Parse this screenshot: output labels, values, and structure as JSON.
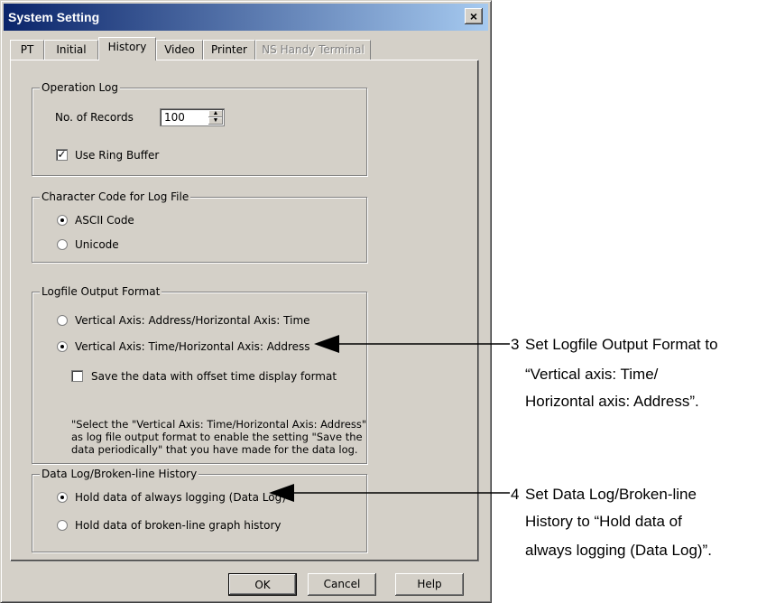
{
  "window": {
    "title": "System Setting",
    "close_glyph": "×"
  },
  "tabs": [
    "PT",
    "Initial",
    "History",
    "Video",
    "Printer",
    "NS Handy Terminal"
  ],
  "operation_log": {
    "legend": "Operation Log",
    "records_label": "No. of Records",
    "records_value": "100",
    "ring_buffer_label": "Use Ring Buffer",
    "ring_buffer_checked": true
  },
  "char_code": {
    "legend": "Character Code for Log File",
    "options": [
      "ASCII Code",
      "Unicode"
    ],
    "selected": 0
  },
  "output_format": {
    "legend": "Logfile Output Format",
    "options": [
      "Vertical Axis: Address/Horizontal Axis: Time",
      "Vertical Axis: Time/Horizontal Axis: Address"
    ],
    "selected": 1,
    "offset_label": "Save the data with offset time display format",
    "offset_checked": false,
    "note": "\"Select the \"Vertical Axis: Time/Horizontal Axis: Address\" as log file output format to enable the setting \"Save the data periodically\" that you have made for the data log."
  },
  "data_log": {
    "legend": "Data Log/Broken-line History",
    "options": [
      "Hold data of always logging (Data Log)",
      "Hold data of broken-line graph history"
    ],
    "selected": 0
  },
  "buttons": {
    "ok": "OK",
    "cancel": "Cancel",
    "help": "Help"
  },
  "annotations": {
    "step3": {
      "num": "3",
      "lines": [
        "Set Logfile Output Format to",
        "“Vertical axis: Time/",
        "Horizontal axis: Address”."
      ]
    },
    "step4": {
      "num": "4",
      "lines": [
        "Set Data Log/Broken-line",
        "History to “Hold data of",
        "always logging (Data Log)”."
      ]
    }
  }
}
